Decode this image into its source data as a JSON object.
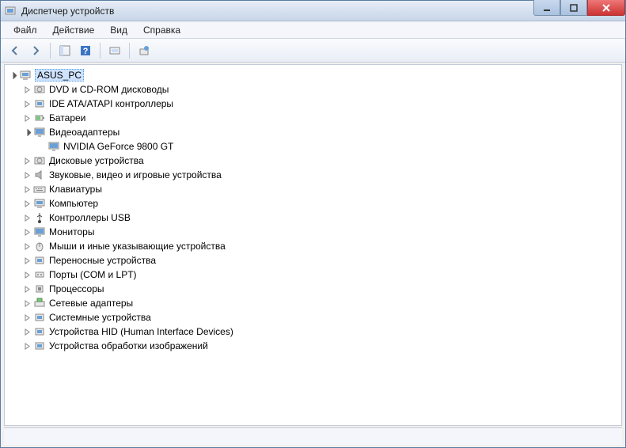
{
  "window": {
    "title": "Диспетчер устройств"
  },
  "menu": {
    "file": "Файл",
    "action": "Действие",
    "view": "Вид",
    "help": "Справка"
  },
  "tree": {
    "root": "ASUS_PC",
    "items": [
      {
        "label": "DVD и CD-ROM дисководы",
        "icon": "disc-drive-icon"
      },
      {
        "label": "IDE ATA/ATAPI контроллеры",
        "icon": "controller-icon"
      },
      {
        "label": "Батареи",
        "icon": "battery-icon"
      },
      {
        "label": "Видеоадаптеры",
        "icon": "display-adapter-icon",
        "expanded": true,
        "children": [
          {
            "label": "NVIDIA GeForce 9800 GT",
            "icon": "display-adapter-icon"
          }
        ]
      },
      {
        "label": "Дисковые устройства",
        "icon": "disk-icon"
      },
      {
        "label": "Звуковые, видео и игровые устройства",
        "icon": "sound-icon"
      },
      {
        "label": "Клавиатуры",
        "icon": "keyboard-icon"
      },
      {
        "label": "Компьютер",
        "icon": "computer-icon"
      },
      {
        "label": "Контроллеры USB",
        "icon": "usb-icon"
      },
      {
        "label": "Мониторы",
        "icon": "monitor-icon"
      },
      {
        "label": "Мыши и иные указывающие устройства",
        "icon": "mouse-icon"
      },
      {
        "label": "Переносные устройства",
        "icon": "portable-icon"
      },
      {
        "label": "Порты (COM и LPT)",
        "icon": "port-icon"
      },
      {
        "label": "Процессоры",
        "icon": "cpu-icon"
      },
      {
        "label": "Сетевые адаптеры",
        "icon": "network-icon"
      },
      {
        "label": "Системные устройства",
        "icon": "system-icon"
      },
      {
        "label": "Устройства HID (Human Interface Devices)",
        "icon": "hid-icon"
      },
      {
        "label": "Устройства обработки изображений",
        "icon": "imaging-icon"
      }
    ]
  }
}
